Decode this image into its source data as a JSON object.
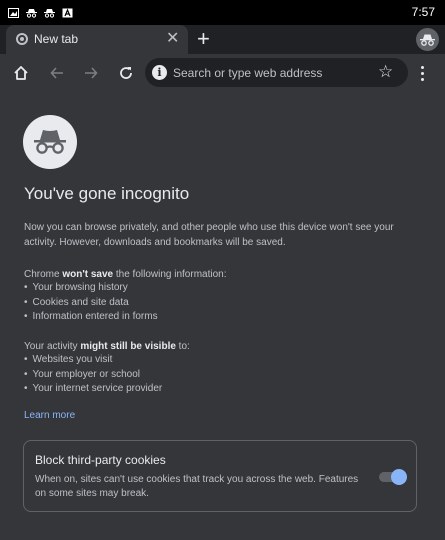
{
  "status_bar": {
    "time": "7:57",
    "icons": [
      "gallery-icon",
      "incognito-icon",
      "incognito-icon",
      "app-notification-icon"
    ]
  },
  "tab": {
    "title": "New tab",
    "close_icon": "close-icon",
    "new_tab_icon": "plus-icon"
  },
  "toolbar": {
    "home_icon": "home-icon",
    "back_icon": "arrow-left-icon",
    "forward_icon": "arrow-right-icon",
    "reload_icon": "reload-icon",
    "omnibox_placeholder": "Search or type web address",
    "bookmark_icon": "star-icon",
    "menu_icon": "more-vert-icon"
  },
  "page": {
    "title": "You've gone incognito",
    "intro": "Now you can browse privately, and other people who use this device won't see your activity. However, downloads and bookmarks will be saved.",
    "wont_save_prefix": "Chrome ",
    "wont_save_bold": "won't save",
    "wont_save_suffix": " the following information:",
    "wont_save_items": [
      "Your browsing history",
      "Cookies and site data",
      "Information entered in forms"
    ],
    "visible_prefix": "Your activity ",
    "visible_bold": "might still be visible",
    "visible_suffix": " to:",
    "visible_items": [
      "Websites you visit",
      "Your employer or school",
      "Your internet service provider"
    ],
    "learn_more": "Learn more"
  },
  "cookies_card": {
    "title": "Block third-party cookies",
    "description": "When on, sites can't use cookies that track you across the web. Features on some sites may break.",
    "toggle_on": true
  },
  "colors": {
    "background": "#35363a",
    "tab_strip": "#202124",
    "link": "#8ab4f8",
    "accent": "#8ab4f8"
  }
}
